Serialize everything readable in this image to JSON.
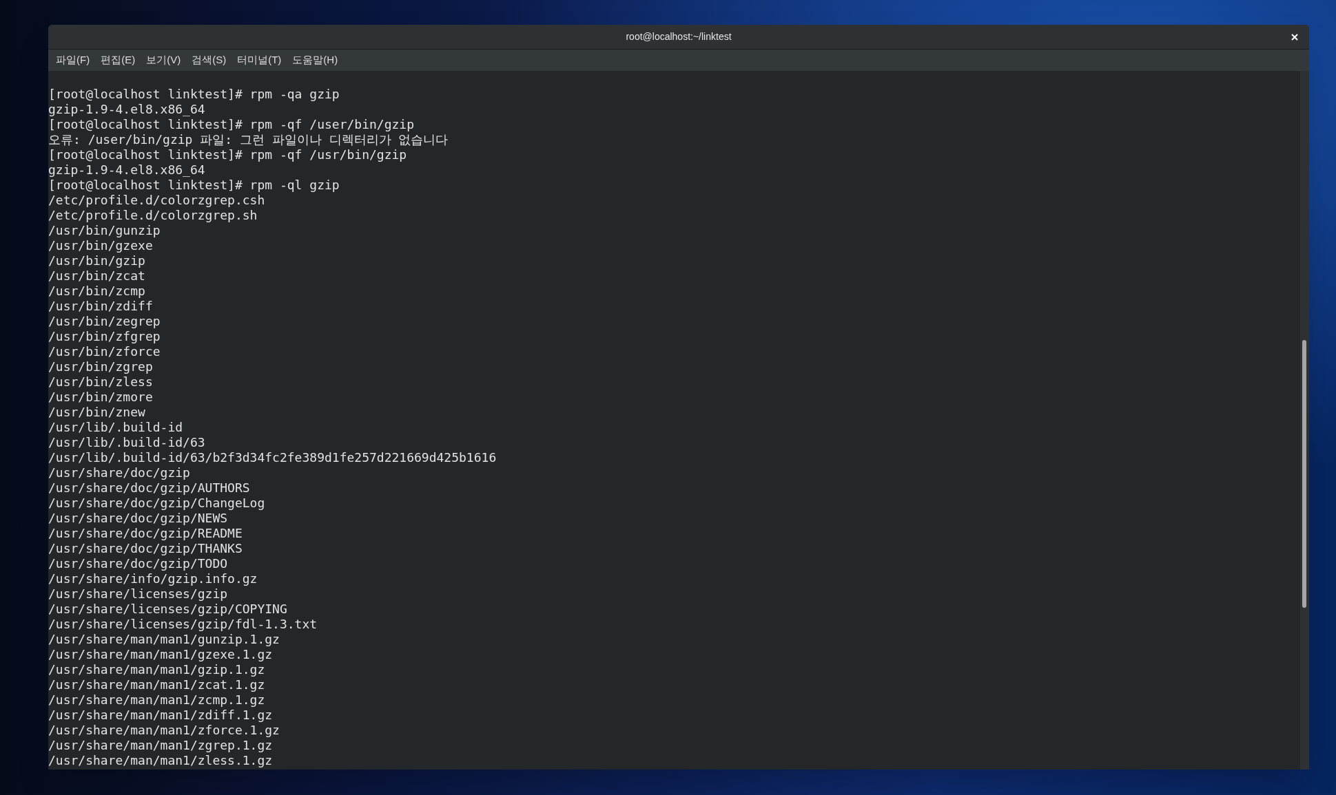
{
  "window": {
    "title": "root@localhost:~/linktest"
  },
  "menu": [
    "파일(F)",
    "편집(E)",
    "보기(V)",
    "검색(S)",
    "터미널(T)",
    "도움말(H)"
  ],
  "terminal_lines": [
    "[root@localhost linktest]# rpm -qa gzip",
    "gzip-1.9-4.el8.x86_64",
    "[root@localhost linktest]# rpm -qf /user/bin/gzip",
    "오류: /user/bin/gzip 파일: 그런 파일이나 디렉터리가 없습니다",
    "[root@localhost linktest]# rpm -qf /usr/bin/gzip",
    "gzip-1.9-4.el8.x86_64",
    "[root@localhost linktest]# rpm -ql gzip",
    "/etc/profile.d/colorzgrep.csh",
    "/etc/profile.d/colorzgrep.sh",
    "/usr/bin/gunzip",
    "/usr/bin/gzexe",
    "/usr/bin/gzip",
    "/usr/bin/zcat",
    "/usr/bin/zcmp",
    "/usr/bin/zdiff",
    "/usr/bin/zegrep",
    "/usr/bin/zfgrep",
    "/usr/bin/zforce",
    "/usr/bin/zgrep",
    "/usr/bin/zless",
    "/usr/bin/zmore",
    "/usr/bin/znew",
    "/usr/lib/.build-id",
    "/usr/lib/.build-id/63",
    "/usr/lib/.build-id/63/b2f3d34fc2fe389d1fe257d221669d425b1616",
    "/usr/share/doc/gzip",
    "/usr/share/doc/gzip/AUTHORS",
    "/usr/share/doc/gzip/ChangeLog",
    "/usr/share/doc/gzip/NEWS",
    "/usr/share/doc/gzip/README",
    "/usr/share/doc/gzip/THANKS",
    "/usr/share/doc/gzip/TODO",
    "/usr/share/info/gzip.info.gz",
    "/usr/share/licenses/gzip",
    "/usr/share/licenses/gzip/COPYING",
    "/usr/share/licenses/gzip/fdl-1.3.txt",
    "/usr/share/man/man1/gunzip.1.gz",
    "/usr/share/man/man1/gzexe.1.gz",
    "/usr/share/man/man1/gzip.1.gz",
    "/usr/share/man/man1/zcat.1.gz",
    "/usr/share/man/man1/zcmp.1.gz",
    "/usr/share/man/man1/zdiff.1.gz",
    "/usr/share/man/man1/zforce.1.gz",
    "/usr/share/man/man1/zgrep.1.gz",
    "/usr/share/man/man1/zless.1.gz"
  ]
}
